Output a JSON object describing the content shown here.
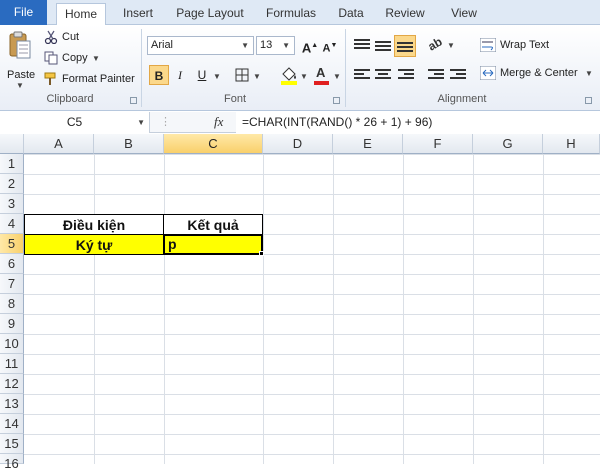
{
  "tabs": [
    {
      "label": "File"
    },
    {
      "label": "Home"
    },
    {
      "label": "Insert"
    },
    {
      "label": "Page Layout"
    },
    {
      "label": "Formulas"
    },
    {
      "label": "Data"
    },
    {
      "label": "Review"
    },
    {
      "label": "View"
    }
  ],
  "clipboard": {
    "paste": "Paste",
    "cut": "Cut",
    "copy": "Copy",
    "format_painter": "Format Painter",
    "label": "Clipboard"
  },
  "font": {
    "name": "Arial",
    "size": "13",
    "label": "Font",
    "bold": "B",
    "italic": "I",
    "underline": "U",
    "grow": "A",
    "shrink": "A"
  },
  "alignment": {
    "wrap_text": "Wrap Text",
    "merge_center": "Merge & Center",
    "label": "Alignment"
  },
  "formula_bar": {
    "name_box": "C5",
    "fx": "fx",
    "formula": "=CHAR(INT(RAND() * 26 + 1) + 96)"
  },
  "grid": {
    "columns": [
      "A",
      "B",
      "C",
      "D",
      "E",
      "F",
      "G",
      "H"
    ],
    "rows": [
      "1",
      "2",
      "3",
      "4",
      "5",
      "6",
      "7",
      "8",
      "9",
      "10",
      "11",
      "12",
      "13",
      "14",
      "15",
      "16"
    ],
    "cells": {
      "header_condition": "Điều kiện",
      "header_result": "Kết quả",
      "char_label": "Ký tự",
      "result_value": "p"
    }
  },
  "colors": {
    "file_tab": "#2a6bc0",
    "highlight_yellow": "#ffff00",
    "selected_header": "#f9d06b",
    "font_color_red": "#e02020",
    "fill_color_yellow": "#ffff00"
  }
}
